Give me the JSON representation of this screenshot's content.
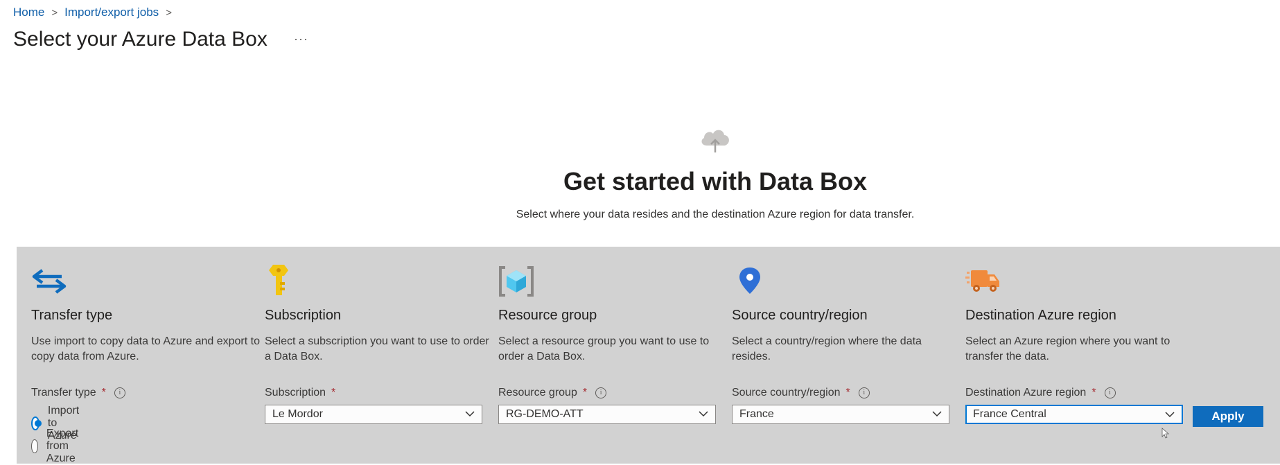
{
  "breadcrumb": {
    "home": "Home",
    "jobs": "Import/export jobs",
    "separator": ">"
  },
  "page": {
    "title": "Select your Azure Data Box",
    "more": "···"
  },
  "hero": {
    "icon": "cloud-upload-icon",
    "title": "Get started with Data Box",
    "subtitle": "Select where your data resides and the destination Azure region for data transfer."
  },
  "columns": {
    "transfer": {
      "icon": "transfer-arrows-icon",
      "title": "Transfer type",
      "description": "Use import to copy data to Azure and export to copy data from Azure.",
      "label": "Transfer type",
      "options": [
        "Import to Azure",
        "Export from Azure"
      ],
      "selected": "Import to Azure"
    },
    "subscription": {
      "icon": "key-icon",
      "title": "Subscription",
      "description": "Select a subscription you want to use to order a Data Box.",
      "label": "Subscription",
      "value": "Le Mordor"
    },
    "resource_group": {
      "icon": "resource-group-icon",
      "title": "Resource group",
      "description": "Select a resource group you want to use to order a Data Box.",
      "label": "Resource group",
      "value": "RG-DEMO-ATT"
    },
    "source": {
      "icon": "location-pin-icon",
      "title": "Source country/region",
      "description": "Select a country/region where the data resides.",
      "label": "Source country/region",
      "value": "France"
    },
    "destination": {
      "icon": "delivery-truck-icon",
      "title": "Destination Azure region",
      "description": "Select an Azure region where you want to transfer the data.",
      "label": "Destination Azure region",
      "value": "France Central"
    }
  },
  "actions": {
    "apply": "Apply"
  },
  "required_marker": "*",
  "info_glyph": "i",
  "colors": {
    "link": "#0f5ea8",
    "accent": "#0078d4",
    "button": "#0f6cbd",
    "panel": "#d2d2d2",
    "required": "#a4262c"
  }
}
